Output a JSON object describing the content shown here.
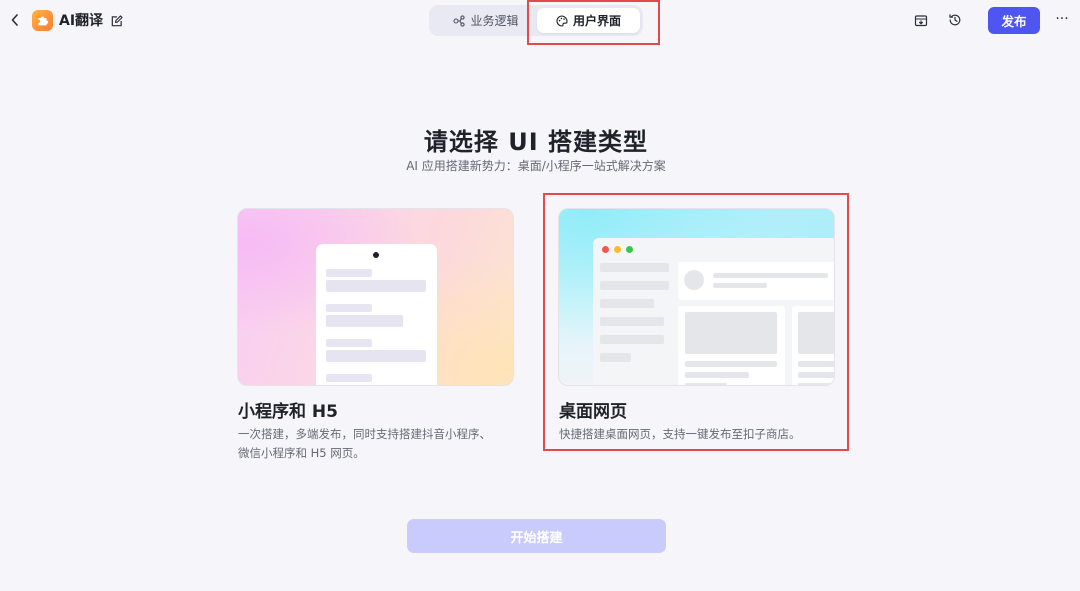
{
  "header": {
    "app_name": "AI翻译",
    "tabs": [
      {
        "label": "业务逻辑",
        "icon": "flow-icon",
        "active": false
      },
      {
        "label": "用户界面",
        "icon": "palette-icon",
        "active": true
      }
    ],
    "publish_label": "发布",
    "more_label": "···"
  },
  "main": {
    "title": "请选择 UI 搭建类型",
    "subtitle": "AI 应用搭建新势力：桌面/小程序一站式解决方案",
    "options": [
      {
        "title": "小程序和 H5",
        "desc_lines": [
          "一次搭建，多端发布，同时支持搭建抖音小程序、",
          "微信小程序和 H5 网页。"
        ],
        "selected": false
      },
      {
        "title": "桌面网页",
        "desc_lines": [
          "快捷搭建桌面网页，支持一键发布至扣子商店。"
        ],
        "selected": true
      }
    ],
    "start_label": "开始搭建"
  },
  "colors": {
    "accent": "#4f55f1",
    "accent_disabled": "#c8cbfb",
    "highlight": "#e34a4a",
    "background": "#f6f6fa"
  }
}
